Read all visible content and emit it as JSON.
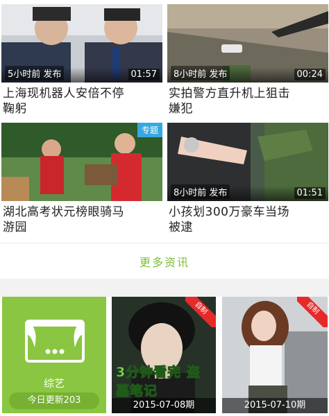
{
  "news": [
    {
      "time_ago": "5小时前 发布",
      "duration": "01:57",
      "title_line1": "上海现机器人安倍不停",
      "title_line2": "鞠躬"
    },
    {
      "time_ago": "8小时前 发布",
      "duration": "00:24",
      "title_line1": "实拍警方直升机上狙击",
      "title_line2": "嫌犯"
    },
    {
      "badge": "专题",
      "title_line1": "湖北高考状元榜眼骑马",
      "title_line2": "游园"
    },
    {
      "time_ago": "8小时前 发布",
      "duration": "01:51",
      "title_line1": "小孩划300万豪车当场",
      "title_line2": "被逮"
    }
  ],
  "more_link": "更多资讯",
  "variety": {
    "label": "综艺",
    "update": "今日更新203"
  },
  "videos": [
    {
      "corner": "自制",
      "caption": "3分钟看完 盗墓笔记",
      "date": "2015-07-08期"
    },
    {
      "corner": "自制",
      "date": "2015-07-10期"
    }
  ],
  "colors": {
    "accent_green": "#7cbf36",
    "tile_green": "#8ac641",
    "badge_blue": "#38a8e0",
    "corner_red": "#e62a2a"
  }
}
